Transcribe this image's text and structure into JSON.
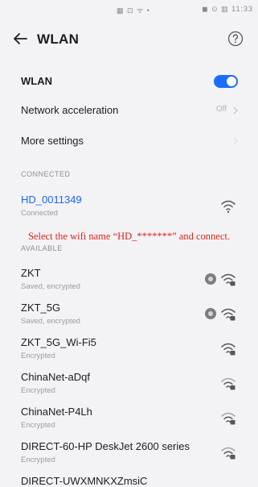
{
  "status_bar": {
    "center_icons": "▦ ⊡ ᯤ •",
    "right_icons": "◼ ⊙ ▥ 11:33"
  },
  "header": {
    "title": "WLAN",
    "back_icon": "back-arrow-icon",
    "help_icon": "question-circle-icon"
  },
  "settings": {
    "wlan_label": "WLAN",
    "wlan_enabled": true,
    "network_acceleration_label": "Network acceleration",
    "network_acceleration_value": "Off",
    "more_settings_label": "More settings"
  },
  "connected": {
    "section_title": "CONNECTED",
    "name": "HD_0011349",
    "status": "Connected"
  },
  "instruction": "Select the wifi name “HD_*******” and connect.",
  "available": {
    "section_title": "AVAILABLE",
    "networks": [
      {
        "name": "ZKT",
        "status": "Saved, encrypted",
        "saved": true
      },
      {
        "name": "ZKT_5G",
        "status": "Saved, encrypted",
        "saved": true
      },
      {
        "name": "ZKT_5G_Wi-Fi5",
        "status": "Encrypted",
        "saved": false
      },
      {
        "name": "ChinaNet-aDqf",
        "status": "Encrypted",
        "saved": false
      },
      {
        "name": "ChinaNet-P4Lh",
        "status": "Encrypted",
        "saved": false
      },
      {
        "name": "DIRECT-60-HP DeskJet 2600 series",
        "status": "Encrypted",
        "saved": false
      },
      {
        "name": "DIRECT-UWXMNKXZmsiC",
        "status": "",
        "saved": false
      }
    ]
  },
  "colors": {
    "accent": "#1a66ff",
    "instruction": "#e0211d",
    "background": "#f3f3f5"
  }
}
